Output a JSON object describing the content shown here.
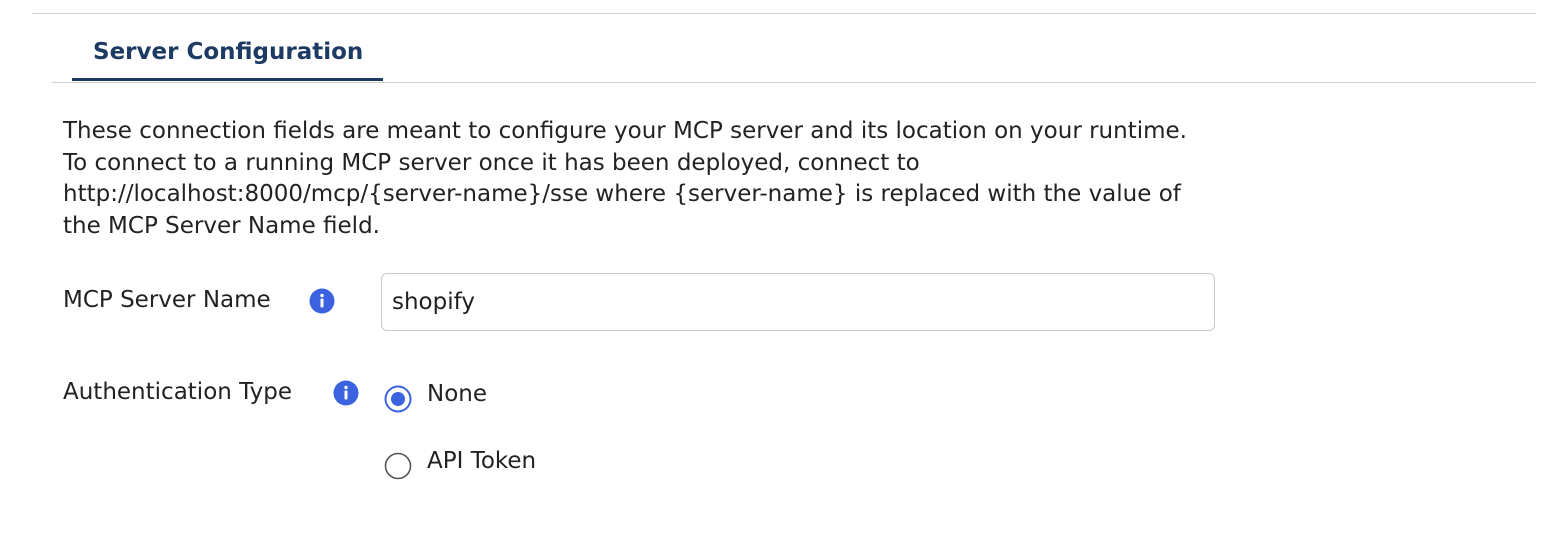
{
  "tabs": [
    {
      "label": "Server Configuration",
      "active": true
    }
  ],
  "description_lines": [
    "These connection fields are meant to configure your MCP server and its location on your runtime.",
    "To connect to a running MCP server once it has been deployed, connect to",
    "http://localhost:8000/mcp/{server-name}/sse where {server-name} is replaced with the value of",
    "the MCP Server Name field."
  ],
  "fields": {
    "server_name": {
      "label": "MCP Server Name",
      "value": "shopify"
    },
    "auth_type": {
      "label": "Authentication Type",
      "options": [
        {
          "label": "None",
          "selected": true
        },
        {
          "label": "API Token",
          "selected": false
        }
      ]
    }
  },
  "icons": {
    "info": "info-icon",
    "radio": "radio-button-icon"
  },
  "colors": {
    "accent": "#3b63e0",
    "tab_active": "#1d3a63",
    "radio_border_selected": "#3b63e0",
    "radio_border_unselected": "#555555"
  }
}
